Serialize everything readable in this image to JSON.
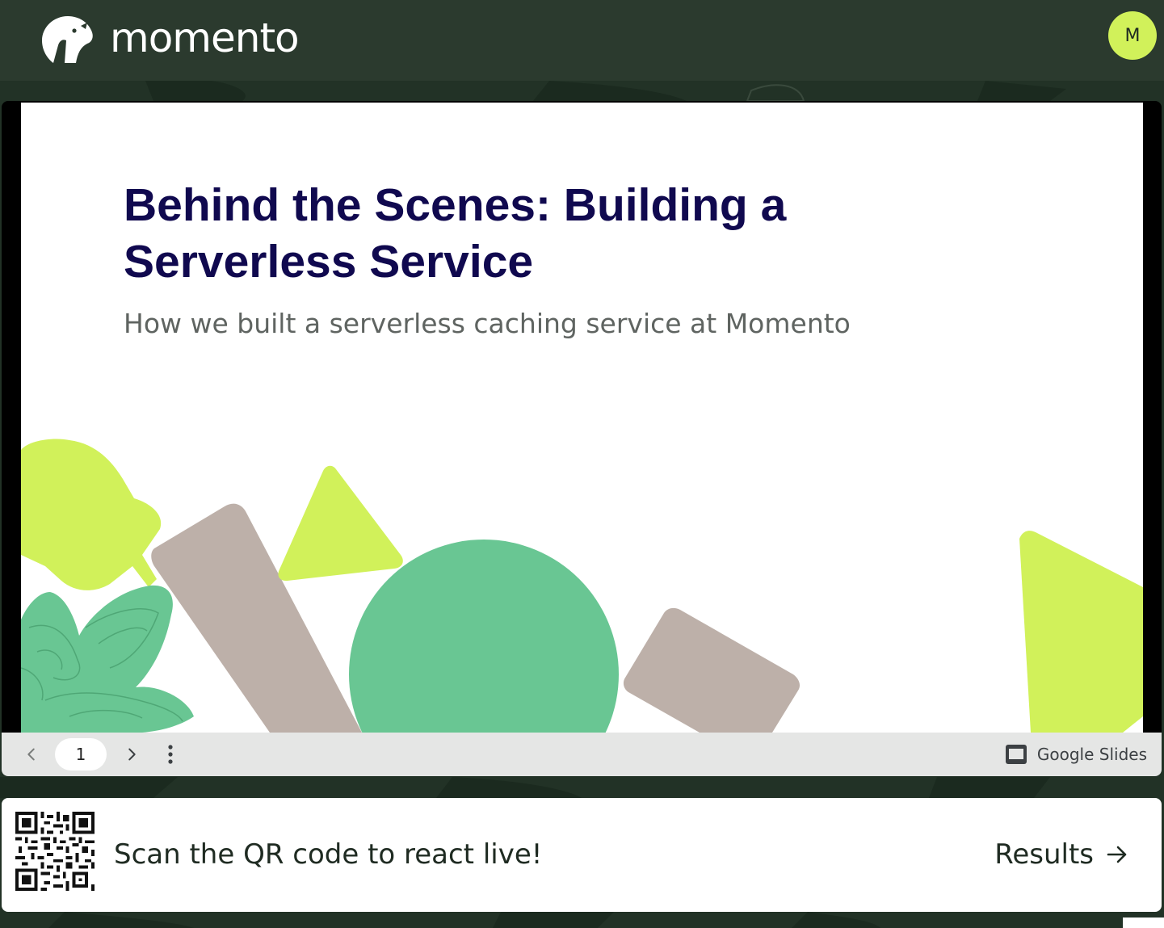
{
  "header": {
    "brand": "momento",
    "avatar_initial": "M"
  },
  "slide": {
    "title": "Behind the Scenes: Building a\nServerless Service",
    "subtitle": "How we built a serverless caching service at Momento"
  },
  "viewer_controls": {
    "prev_icon": "chevron-left-icon",
    "page_number": "1",
    "next_icon": "chevron-right-icon",
    "more_icon": "more-vertical-icon",
    "provider_label": "Google Slides",
    "provider_icon": "google-slides-icon"
  },
  "qr_bar": {
    "prompt": "Scan the QR code to react live!",
    "results_label": "Results",
    "results_icon": "arrow-right-icon"
  },
  "colors": {
    "header_bg": "#2b3a2e",
    "avatar": "#d1f15a",
    "title": "#10094f",
    "lime": "#d1f15a",
    "green": "#69c693",
    "taupe": "#bdb0a9"
  }
}
